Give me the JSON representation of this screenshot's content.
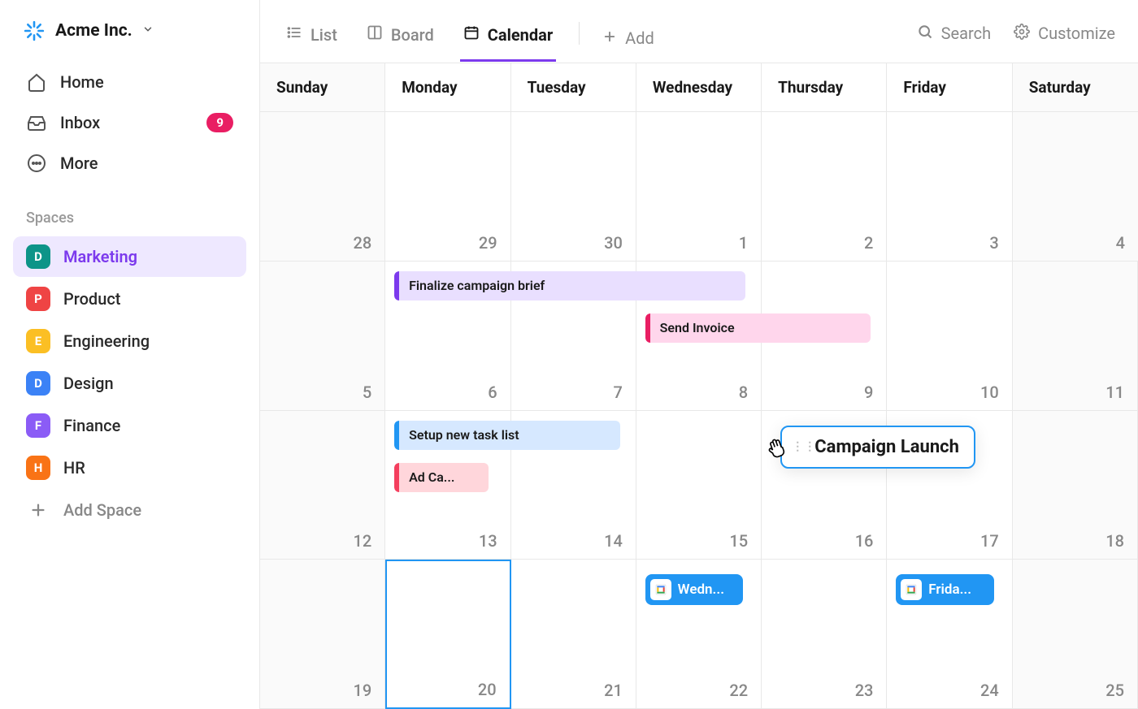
{
  "workspace": {
    "name": "Acme Inc."
  },
  "sidebar": {
    "nav": [
      {
        "label": "Home",
        "icon": "home"
      },
      {
        "label": "Inbox",
        "icon": "inbox",
        "badge": "9"
      },
      {
        "label": "More",
        "icon": "more"
      }
    ],
    "spaces_label": "Spaces",
    "spaces": [
      {
        "letter": "D",
        "label": "Marketing",
        "color": "#0d9488",
        "active": true
      },
      {
        "letter": "P",
        "label": "Product",
        "color": "#ef4444"
      },
      {
        "letter": "E",
        "label": "Engineering",
        "color": "#fbbf24"
      },
      {
        "letter": "D",
        "label": "Design",
        "color": "#3b82f6"
      },
      {
        "letter": "F",
        "label": "Finance",
        "color": "#8b5cf6"
      },
      {
        "letter": "H",
        "label": "HR",
        "color": "#f97316"
      }
    ],
    "add_space_label": "Add Space"
  },
  "toolbar": {
    "views": [
      {
        "label": "List",
        "icon": "list"
      },
      {
        "label": "Board",
        "icon": "board"
      },
      {
        "label": "Calendar",
        "icon": "calendar",
        "active": true
      }
    ],
    "add_label": "Add",
    "search_label": "Search",
    "customize_label": "Customize"
  },
  "calendar": {
    "days_of_week": [
      "Sunday",
      "Monday",
      "Tuesday",
      "Wednesday",
      "Thursday",
      "Friday",
      "Saturday"
    ],
    "weeks": [
      [
        {
          "n": "28",
          "wk": true
        },
        {
          "n": "29"
        },
        {
          "n": "30"
        },
        {
          "n": "1"
        },
        {
          "n": "2"
        },
        {
          "n": "3"
        },
        {
          "n": "4",
          "wk": true
        }
      ],
      [
        {
          "n": "5",
          "wk": true
        },
        {
          "n": "6"
        },
        {
          "n": "7"
        },
        {
          "n": "8"
        },
        {
          "n": "9"
        },
        {
          "n": "10"
        },
        {
          "n": "11",
          "wk": true
        }
      ],
      [
        {
          "n": "12",
          "wk": true
        },
        {
          "n": "13"
        },
        {
          "n": "14"
        },
        {
          "n": "15"
        },
        {
          "n": "16"
        },
        {
          "n": "17"
        },
        {
          "n": "18",
          "wk": true
        }
      ],
      [
        {
          "n": "19",
          "wk": true
        },
        {
          "n": "20",
          "today": true
        },
        {
          "n": "21"
        },
        {
          "n": "22"
        },
        {
          "n": "23"
        },
        {
          "n": "24"
        },
        {
          "n": "25",
          "wk": true
        }
      ]
    ],
    "events": {
      "finalize": "Finalize campaign brief",
      "invoice": "Send Invoice",
      "setup": "Setup new task list",
      "adca": "Ad Ca...",
      "campaign": "Campaign Launch",
      "wedn": "Wedn...",
      "frida": "Frida..."
    }
  }
}
